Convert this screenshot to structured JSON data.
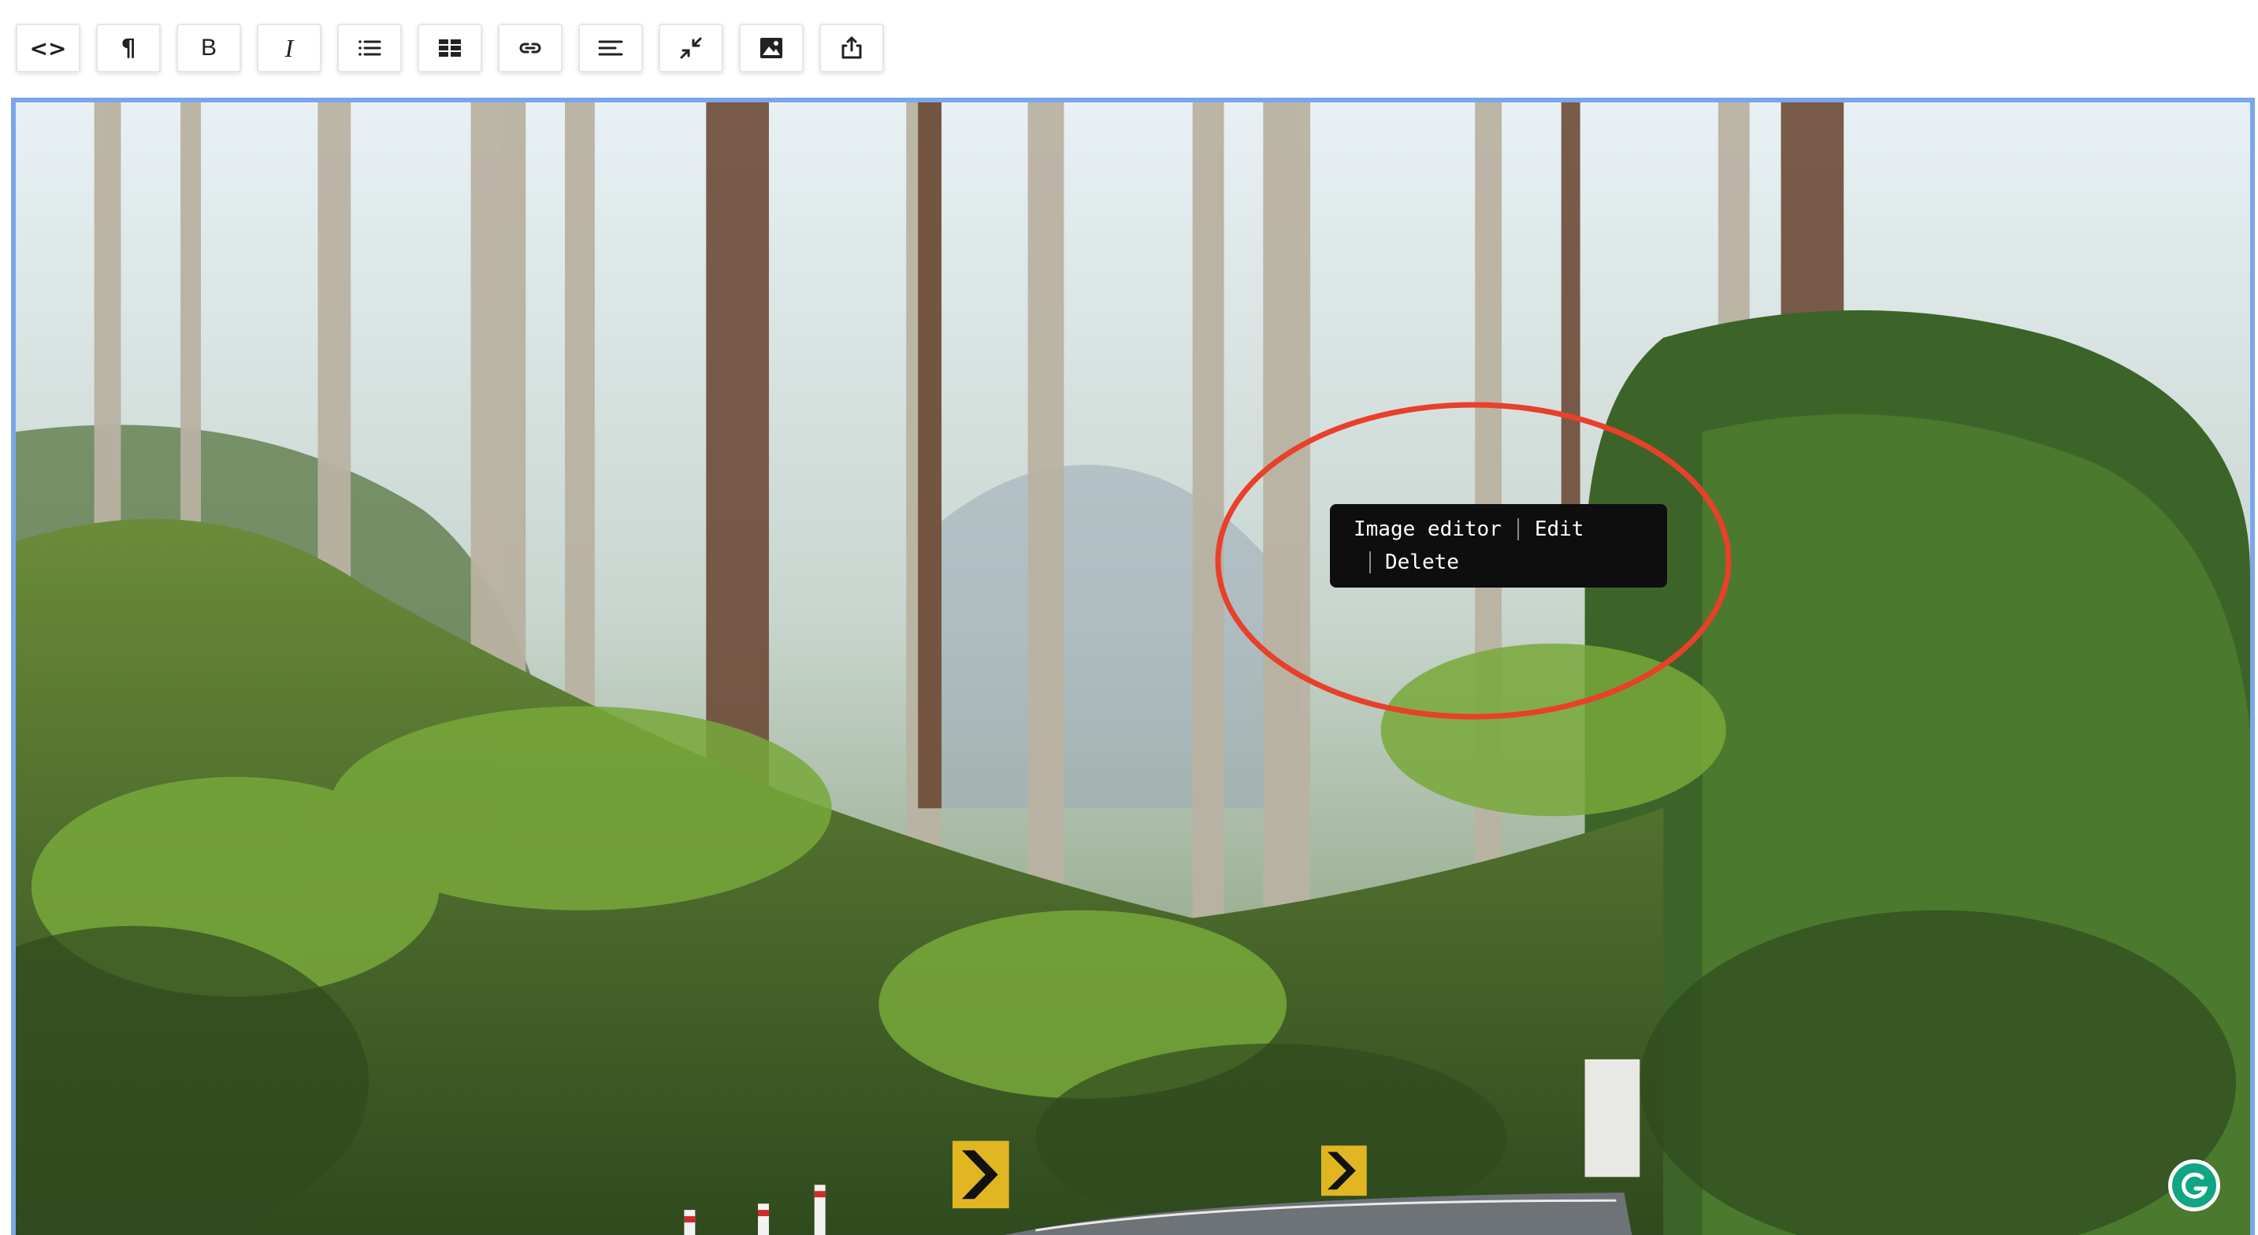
{
  "toolbar": {
    "buttons": [
      {
        "name": "code-view",
        "icon": "code-icon",
        "glyph": "<>"
      },
      {
        "name": "paragraph",
        "icon": "paragraph-icon",
        "glyph": "¶"
      },
      {
        "name": "bold",
        "icon": "bold-icon",
        "glyph": "B"
      },
      {
        "name": "italic",
        "icon": "italic-icon",
        "glyph": "I"
      },
      {
        "name": "list",
        "icon": "list-icon",
        "glyph": ""
      },
      {
        "name": "table",
        "icon": "table-icon",
        "glyph": ""
      },
      {
        "name": "link",
        "icon": "link-icon",
        "glyph": ""
      },
      {
        "name": "align",
        "icon": "align-left-icon",
        "glyph": ""
      },
      {
        "name": "collapse",
        "icon": "collapse-icon",
        "glyph": ""
      },
      {
        "name": "image",
        "icon": "image-icon",
        "glyph": ""
      },
      {
        "name": "export",
        "icon": "export-icon",
        "glyph": ""
      }
    ]
  },
  "image_toolbar": {
    "image_editor_label": "Image editor",
    "edit_label": "Edit",
    "delete_label": "Delete"
  },
  "colors": {
    "selection_border": "#7aa6ea",
    "annotation_ellipse": "#e8402a",
    "menu_background": "#0e0e0e"
  }
}
